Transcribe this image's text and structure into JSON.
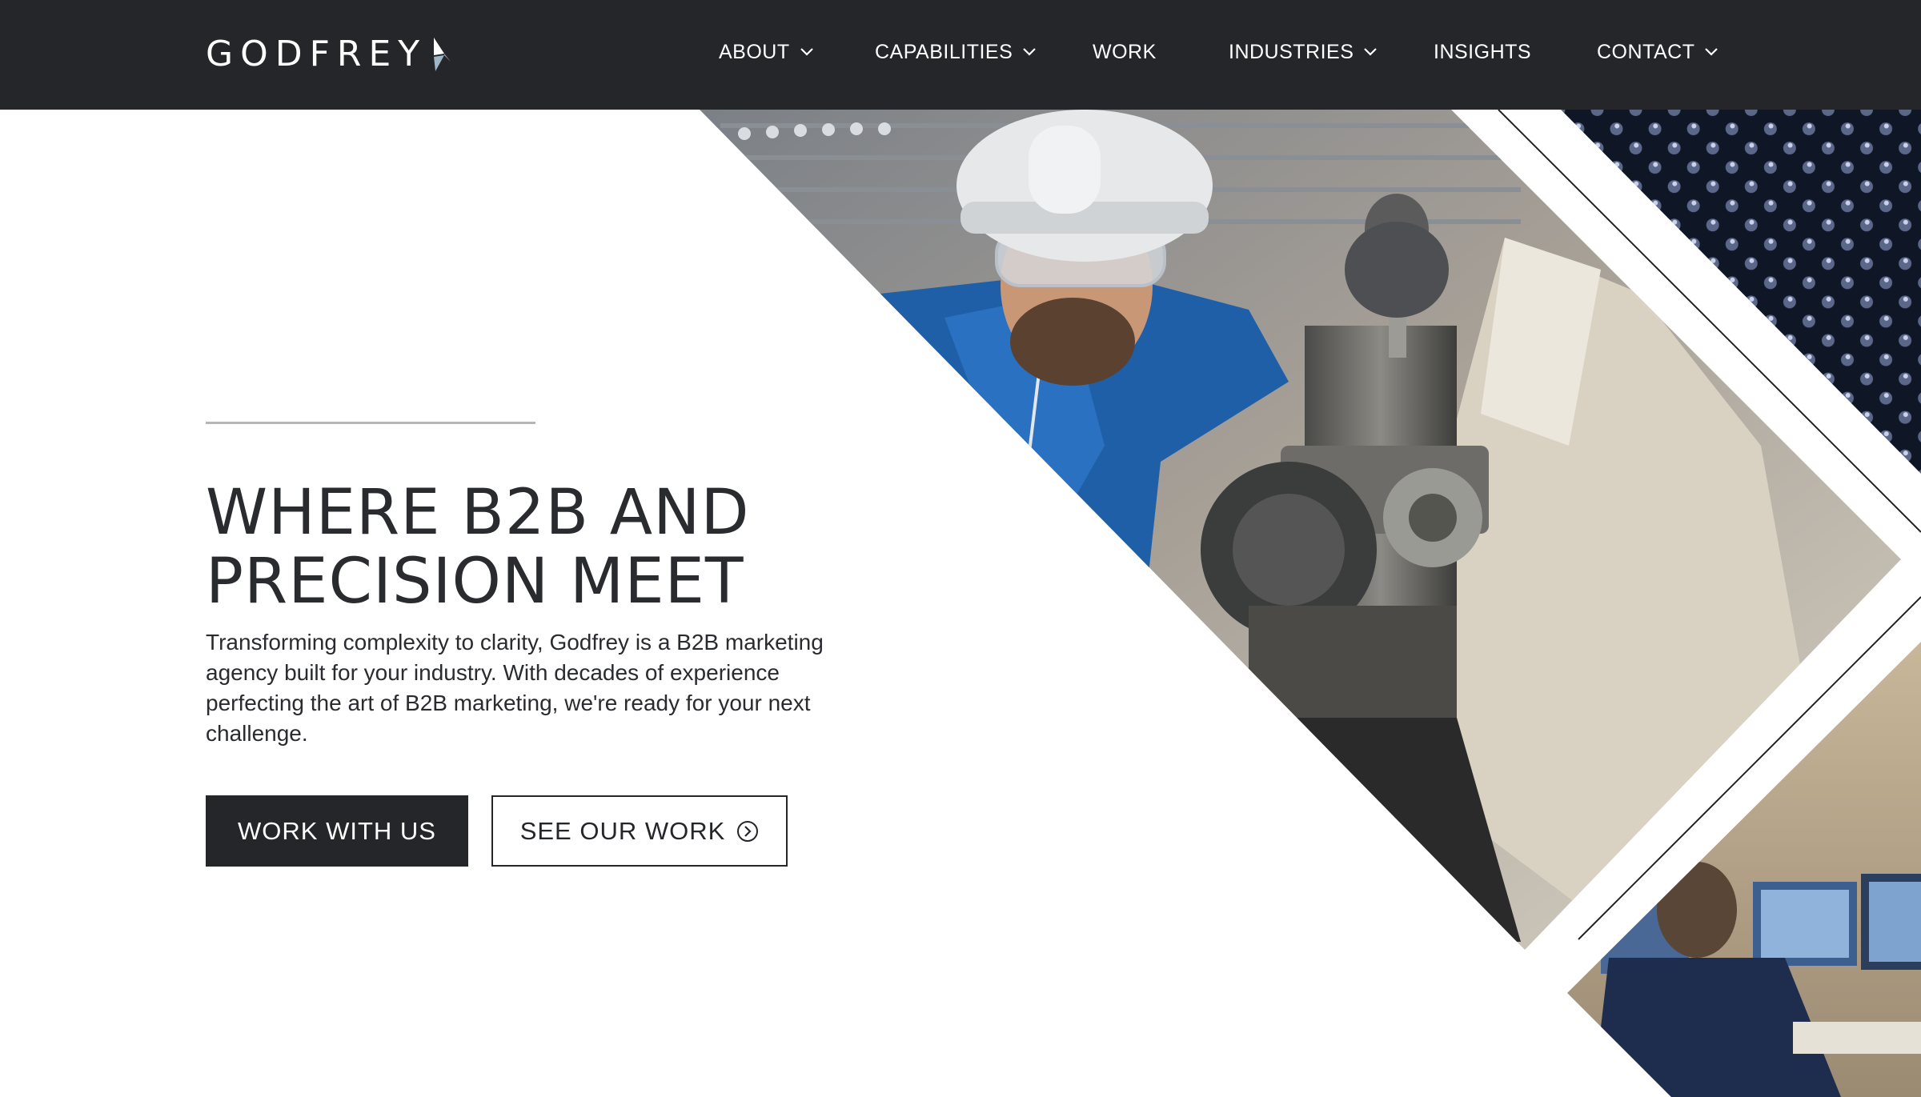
{
  "brand": {
    "name": "GODFREY",
    "accent_color": "#9fb6c8",
    "header_bg": "#25262a"
  },
  "nav": {
    "items": [
      {
        "label": "ABOUT",
        "has_dropdown": true
      },
      {
        "label": "CAPABILITIES",
        "has_dropdown": true
      },
      {
        "label": "WORK",
        "has_dropdown": false
      },
      {
        "label": "INDUSTRIES",
        "has_dropdown": true
      },
      {
        "label": "INSIGHTS",
        "has_dropdown": false
      },
      {
        "label": "CONTACT",
        "has_dropdown": true
      }
    ]
  },
  "hero": {
    "title_line1": "WHERE B2B AND",
    "title_line2": "PRECISION MEET",
    "description": "Transforming complexity to clarity, Godfrey is a B2B marketing agency built for your industry. With decades of experience perfecting the art of B2B marketing, we're ready for your next challenge.",
    "primary_button": "WORK WITH US",
    "secondary_button": "SEE OUR WORK",
    "secondary_button_icon": "chevron-right-circle-icon",
    "images": [
      "worker-at-lathe-photo",
      "dark-textured-material-photo",
      "man-at-computer-monitors-photo"
    ]
  }
}
